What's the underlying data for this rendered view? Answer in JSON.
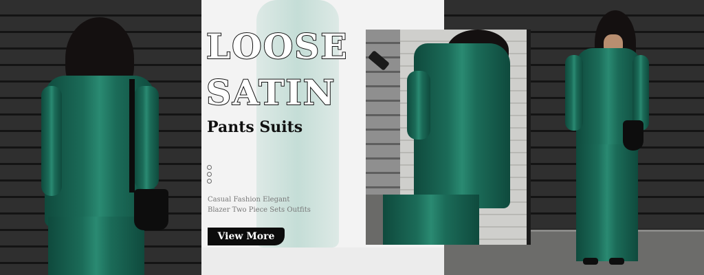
{
  "banner": {
    "title_line1": "LOOSE",
    "title_line2": "SATIN",
    "subtitle": "Pants Suits",
    "description_line1": "Casual Fashion Elegant",
    "description_line2": "Blazer Two Piece Sets Outfits",
    "cta_label": "View More",
    "accent_color": "#1b6b58",
    "button_color": "#0c0c0c"
  }
}
